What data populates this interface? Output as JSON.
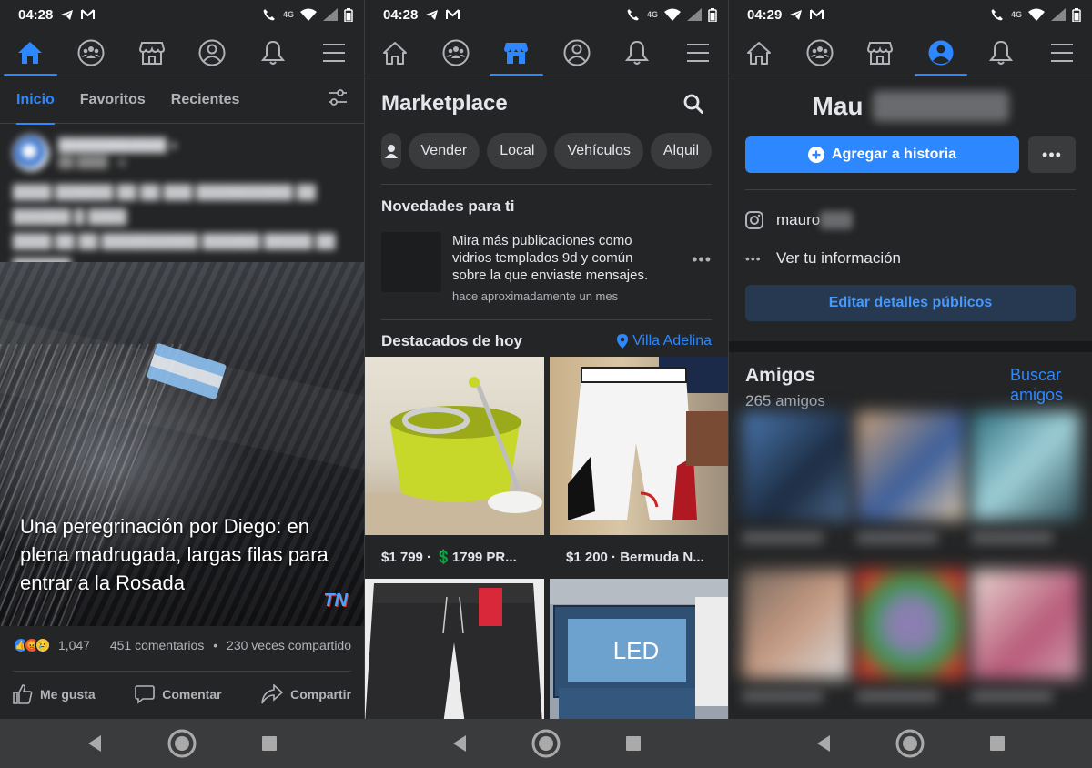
{
  "colors": {
    "accent": "#2d88ff",
    "background": "#242526",
    "surface": "#3a3b3c",
    "text": "#e4e6eb",
    "muted": "#b0b3b8"
  },
  "screen_feed": {
    "status": {
      "time": "04:28",
      "network": "4G"
    },
    "nav": [
      "home-icon",
      "groups-icon",
      "marketplace-icon",
      "profile-icon",
      "bell-icon",
      "menu-icon"
    ],
    "subtabs": {
      "inicio": "Inicio",
      "favoritos": "Favoritos",
      "recientes": "Recientes"
    },
    "post": {
      "caption": "Una peregrinación por Diego: en plena madrugada, largas filas para entrar a la Rosada",
      "logo": "TN",
      "reactions_count": "1,047",
      "comments": "451 comentarios",
      "shares": "230 veces compartido",
      "stats_separator": " • "
    },
    "actions": {
      "like": "Me gusta",
      "comment": "Comentar",
      "share": "Compartir"
    }
  },
  "screen_marketplace": {
    "status": {
      "time": "04:28",
      "network": "4G"
    },
    "title": "Marketplace",
    "chips": {
      "sell": "Vender",
      "local": "Local",
      "vehicles": "Vehículos",
      "rent": "Alquil"
    },
    "novedades": {
      "title": "Novedades para ti",
      "text": "Mira más publicaciones como vidrios templados 9d y común sobre la que enviaste mensajes.",
      "time": "hace aproximadamente un mes"
    },
    "destacados": {
      "title": "Destacados de hoy",
      "location": "Villa Adelina"
    },
    "listings": [
      {
        "label": "$1 799 · 💲1799 PR..."
      },
      {
        "label": "$1 200 · Bermuda N..."
      }
    ]
  },
  "screen_profile": {
    "status": {
      "time": "04:29",
      "network": "4G"
    },
    "name": "Mau",
    "add_story": "Agregar a historia",
    "instagram": "mauro",
    "see_info": "Ver tu información",
    "edit_details": "Editar detalles públicos",
    "friends": {
      "title": "Amigos",
      "count": "265 amigos",
      "find": "Buscar amigos"
    }
  }
}
